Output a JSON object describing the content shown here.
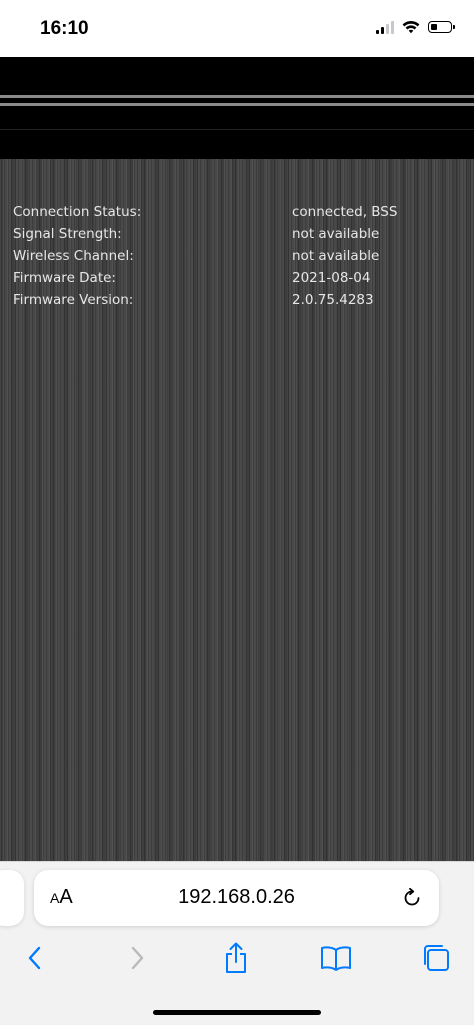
{
  "status_bar": {
    "time": "16:10",
    "icons": [
      "cellular-signal-icon",
      "wifi-icon",
      "battery-icon"
    ]
  },
  "router_status": {
    "rows": [
      {
        "label": "Connection Status:",
        "value": "connected, BSS"
      },
      {
        "label": "Signal Strength:",
        "value": "not available"
      },
      {
        "label": "Wireless Channel:",
        "value": "not available"
      },
      {
        "label": "Firmware Date:",
        "value": "2021-08-04"
      },
      {
        "label": "Firmware Version:",
        "value": "2.0.75.4283"
      }
    ]
  },
  "browser": {
    "text_size_label_large": "A",
    "text_size_label_small": "A",
    "url": "192.168.0.26",
    "toolbar": [
      "back-icon",
      "forward-icon",
      "share-icon",
      "bookmarks-icon",
      "tabs-icon"
    ]
  },
  "colors": {
    "accent": "#007aff",
    "header_bg": "#000000",
    "content_text": "#e6e6e6",
    "toolbar_bg": "#f2f2f2"
  }
}
